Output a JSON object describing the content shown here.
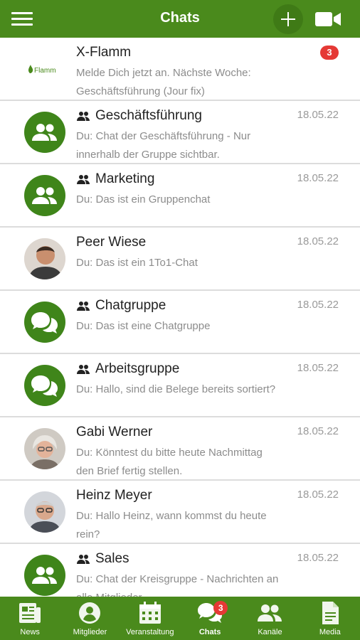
{
  "header": {
    "title": "Chats",
    "menu_icon": "hamburger-menu-icon",
    "add_icon": "plus-icon",
    "video_icon": "video-camera-icon",
    "color": "#4a8a1c"
  },
  "chats": [
    {
      "name": "X-Flamm",
      "preview": "Melde Dich jetzt an. Nächste Woche: Geschäftsführung (Jour fix)",
      "badge": "3",
      "group": false,
      "avatar": "xflamm-logo",
      "logo_text": "Flamm"
    },
    {
      "name": "Geschäftsführung",
      "preview": "Du: Chat der Geschäftsführung - Nur innerhalb der Gruppe sichtbar.",
      "date": "18.05.22",
      "group": true,
      "avatar": "group-icon"
    },
    {
      "name": "Marketing",
      "preview": "Du: Das ist ein Gruppenchat",
      "date": "18.05.22",
      "group": true,
      "avatar": "group-icon"
    },
    {
      "name": "Peer Wiese",
      "preview": "Du: Das ist ein 1To1-Chat",
      "date": "18.05.22",
      "group": false,
      "avatar": "photo-peer-wiese"
    },
    {
      "name": "Chatgruppe",
      "preview": "Du: Das ist eine Chatgruppe",
      "date": "18.05.22",
      "group": true,
      "avatar": "chat-bubbles-icon"
    },
    {
      "name": "Arbeitsgruppe",
      "preview": "Du: Hallo, sind die Belege bereits sortiert?",
      "date": "18.05.22",
      "group": true,
      "avatar": "chat-bubbles-icon"
    },
    {
      "name": "Gabi Werner",
      "preview": "Du: Könntest du bitte heute Nachmittag den Brief fertig stellen.",
      "date": "18.05.22",
      "group": false,
      "avatar": "photo-gabi-werner"
    },
    {
      "name": "Heinz Meyer",
      "preview": "Du: Hallo Heinz, wann kommst du heute rein?",
      "date": "18.05.22",
      "group": false,
      "avatar": "photo-heinz-meyer"
    },
    {
      "name": "Sales",
      "preview": "Du: Chat der Kreisgruppe - Nachrichten an alle Mitglieder",
      "date": "18.05.22",
      "group": true,
      "avatar": "group-icon"
    }
  ],
  "tabs": [
    {
      "label": "News",
      "icon": "newspaper-icon"
    },
    {
      "label": "Mitglieder",
      "icon": "person-icon"
    },
    {
      "label": "Veranstaltung",
      "icon": "calendar-icon"
    },
    {
      "label": "Chats",
      "icon": "chat-bubbles-icon",
      "badge": "3",
      "active": true
    },
    {
      "label": "Kanäle",
      "icon": "group-icon"
    },
    {
      "label": "Media",
      "icon": "document-icon"
    }
  ],
  "colors": {
    "brand_green": "#4a8a1c",
    "avatar_green": "#3f851a",
    "badge_red": "#e53935"
  }
}
